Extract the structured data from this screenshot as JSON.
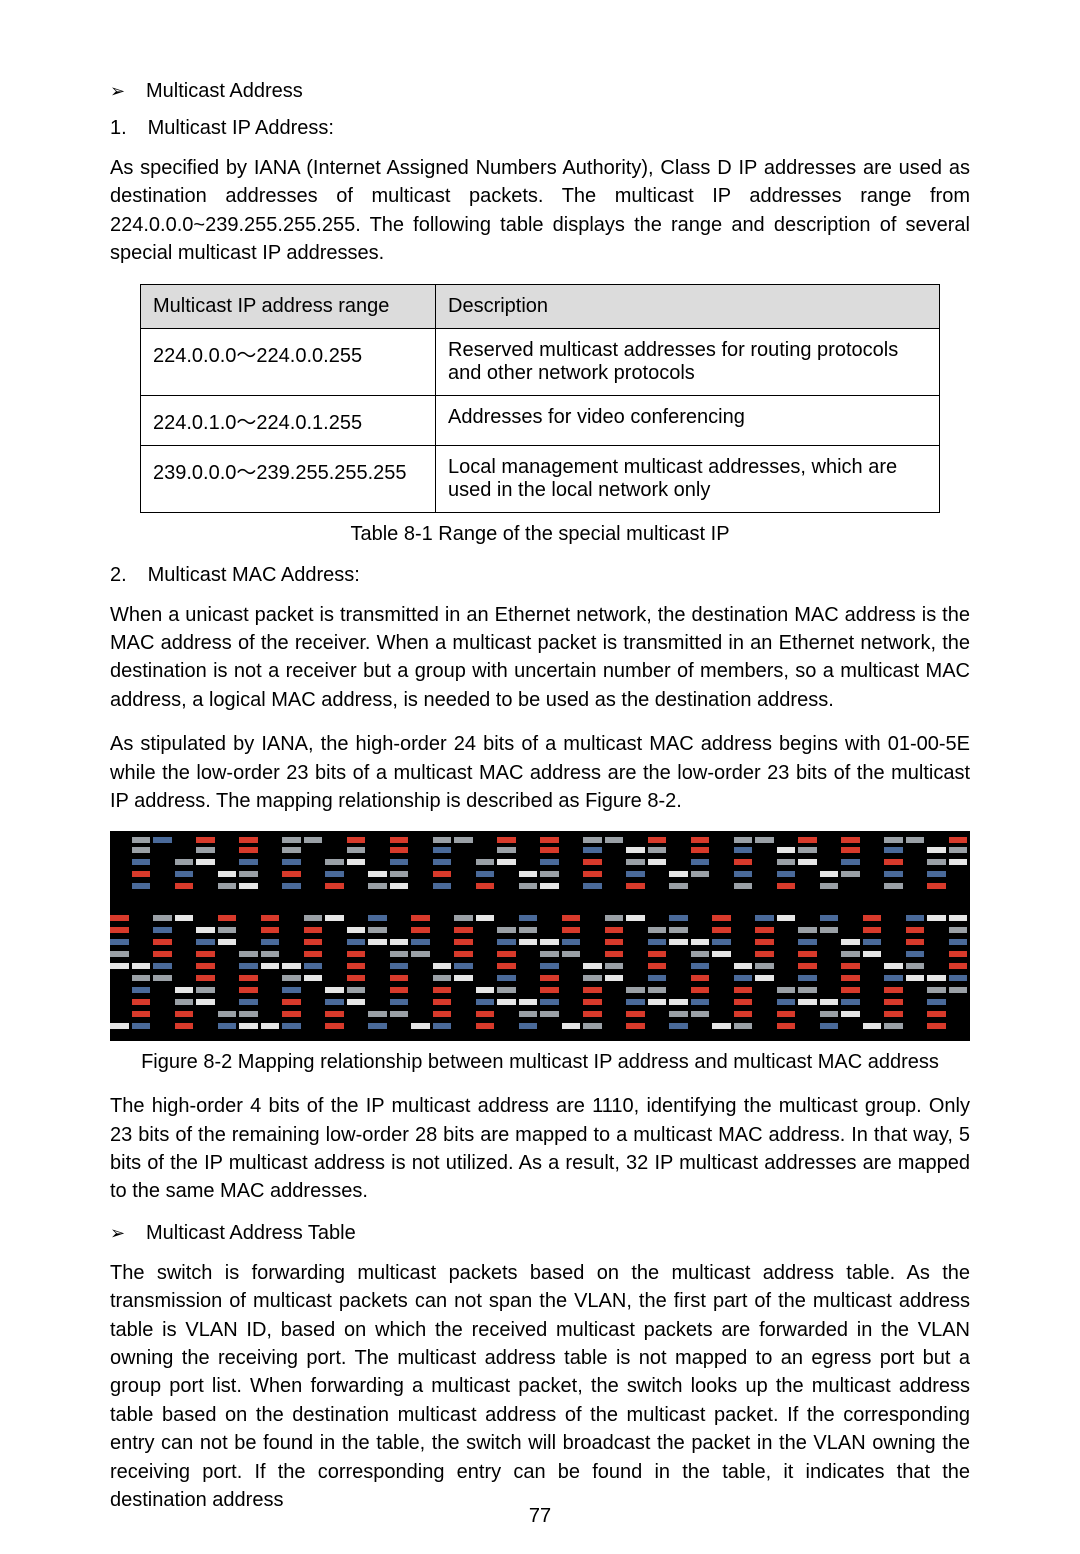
{
  "section1": {
    "bullet_label": "Multicast Address",
    "arrow": "➢",
    "item1_num": "1.",
    "item1_label": "Multicast IP Address:",
    "para1": "As specified by IANA (Internet Assigned Numbers Authority), Class D IP addresses are used as destination addresses of multicast packets. The multicast IP addresses range from 224.0.0.0~239.255.255.255. The following table displays the range and description of several special multicast IP addresses."
  },
  "table1": {
    "headers": [
      "Multicast IP address range",
      "Description"
    ],
    "rows": [
      {
        "range": "224.0.0.0～224.0.0.255",
        "desc": "Reserved multicast addresses for routing protocols and other network protocols"
      },
      {
        "range": "224.0.1.0～224.0.1.255",
        "desc": "Addresses for video conferencing"
      },
      {
        "range": "239.0.0.0～239.255.255.255",
        "desc": "Local management multicast addresses, which are used in the local network only"
      }
    ],
    "caption": "Table 8-1 Range of the special multicast IP"
  },
  "section2": {
    "item2_num": "2.",
    "item2_label": "Multicast MAC Address:",
    "para1": "When a unicast packet is transmitted in an Ethernet network, the destination MAC address is the MAC address of the receiver. When a multicast packet is transmitted in an Ethernet network, the destination is not a receiver but a group with uncertain number of members, so a multicast MAC address, a logical MAC address, is needed to be used as the destination address.",
    "para2": "As stipulated by IANA, the high-order 24 bits of a multicast MAC address begins with 01-00-5E while the low-order 23 bits of a multicast MAC address are the low-order 23 bits of the multicast IP address. The mapping relationship is described as Figure 8-2."
  },
  "figure": {
    "caption": "Figure 8-2 Mapping relationship between multicast IP address and multicast MAC address"
  },
  "section3": {
    "para1": "The high-order 4 bits of the IP multicast address are 1110, identifying the multicast group. Only 23 bits of the remaining low-order 28 bits are mapped to a multicast MAC address. In that way, 5 bits of the IP multicast address is not utilized. As a result, 32 IP multicast addresses are mapped to the same MAC addresses.",
    "bullet_label": "Multicast Address Table",
    "para2": "The switch is forwarding multicast packets based on the multicast address table. As the transmission of multicast packets can not span the VLAN, the first part of the multicast address table is VLAN ID, based on which the received multicast packets are forwarded in the VLAN owning the receiving port. The multicast address table is not mapped to an egress port but a group port list. When forwarding a multicast packet, the switch looks up the multicast address table based on the destination multicast address of the multicast packet. If the corresponding entry can not be found in the table, the switch will broadcast the packet in the VLAN owning the receiving port. If the corresponding entry can be found in the table, it indicates that the destination address"
  },
  "page_number": "77"
}
